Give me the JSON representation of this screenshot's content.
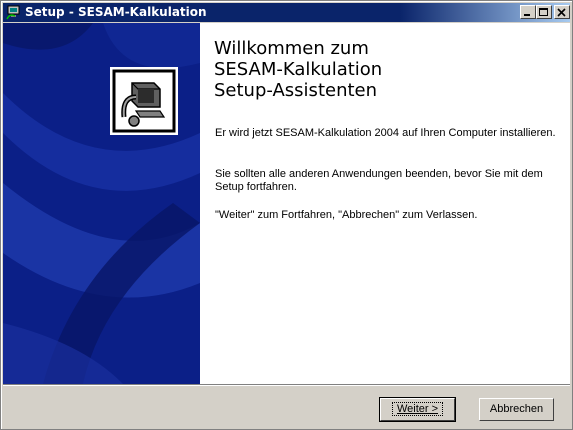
{
  "window": {
    "title": "Setup - SESAM-Kalkulation",
    "icon": "setup-icon",
    "controls": [
      "minimize-icon",
      "maximize-icon",
      "close-icon"
    ]
  },
  "banner": {
    "logo_icon": "computer-install-icon"
  },
  "content": {
    "welcome_line1": "Willkommen zum",
    "welcome_line2": "SESAM-Kalkulation",
    "welcome_line3": "Setup-Assistenten",
    "paragraph1": "Er wird jetzt SESAM-Kalkulation 2004 auf Ihren Computer installieren.",
    "paragraph2": "Sie sollten alle anderen Anwendungen beenden, bevor Sie mit dem Setup fortfahren.",
    "paragraph3": "\"Weiter\" zum Fortfahren, \"Abbrechen\" zum Verlassen."
  },
  "buttons": {
    "next_label": "Weiter >",
    "cancel_label": "Abbrechen"
  },
  "colors": {
    "titlebar": "#0a246a",
    "banner": "#0b1f87",
    "face": "#d4d0c8"
  }
}
